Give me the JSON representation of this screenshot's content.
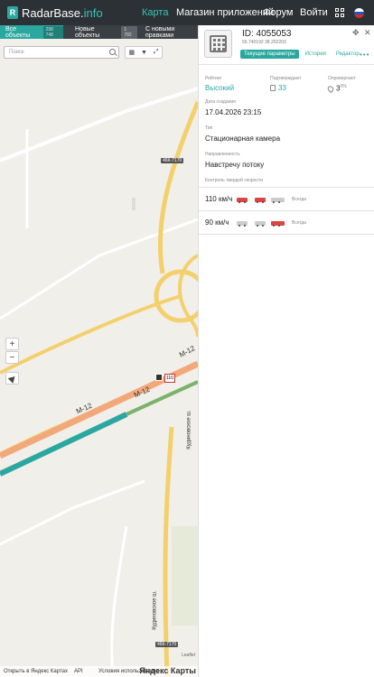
{
  "header": {
    "logo_letter": "R",
    "logo_main": "RadarBase.",
    "logo_accent": "info",
    "nav": [
      "Карта",
      "Магазин приложений",
      "Форум",
      "Войти"
    ],
    "nav_active": "Карта",
    "grid_icon": "grid-icon",
    "flag_icon": "russia-flag-icon"
  },
  "tabs": [
    {
      "label": "Все объекты",
      "count": "298 748"
    },
    {
      "label": "Новые объекты",
      "count": "1 782"
    },
    {
      "label": "С новыми правками",
      "count": ""
    }
  ],
  "map": {
    "search_placeholder": "Поиск",
    "tools": [
      "layers-icon",
      "filter-icon",
      "expand-icon"
    ],
    "zoom_in": "+",
    "zoom_out": "−",
    "road_m12_a": "М-12",
    "road_m12_b": "М-12",
    "road_m12_c": "М-12",
    "road_kudinovskoe_a": "Кудиновское ш.",
    "road_kudinovskoe_b": "Кудиновское ш.",
    "shield_a": "46К-7170",
    "shield_b": "46К-7170",
    "speed_sign": "110",
    "footer_open": "Открыть в Яндекс Картах",
    "footer_api": "API",
    "footer_terms": "Условия использования",
    "yandex": "Яндекс Карты",
    "leaflet": "Leaflet"
  },
  "panel": {
    "id": "ID: 4055053",
    "coords": "55.740192 38.202203",
    "tabs": [
      "Текущие параметры",
      "История",
      "Редактор"
    ],
    "active_tab": "Текущие параметры",
    "rating_label": "Рейтинг",
    "rating_value": "Высокий",
    "confirm_label": "Подтверждают",
    "confirm_value": "33",
    "deny_label": "Опровергают",
    "deny_value": "3",
    "deny_pct": "0%",
    "date_label": "Дата создания",
    "date_value": "17.04.2026 23:15",
    "type_label": "Тип",
    "type_value": "Стационарная камера",
    "direction_label": "Направленность",
    "direction_value": "Навстречу потоку",
    "speed_label": "Контроль твердой скорости",
    "speeds": [
      {
        "value": "110 км/ч",
        "lane": "Всегда"
      },
      {
        "value": "90 км/ч",
        "lane": "Всегда"
      }
    ]
  }
}
